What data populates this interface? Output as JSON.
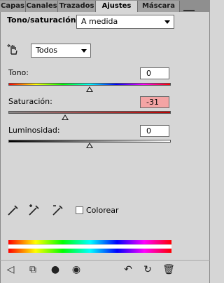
{
  "tabs": [
    "Capas",
    "Canales",
    "Trazados",
    "Ajustes",
    "Máscara"
  ],
  "panel": {
    "title": "Tono/saturación",
    "preset": "A medida",
    "channel": "Todos"
  },
  "adjustments": {
    "tono": {
      "label": "Tono:",
      "value": "0",
      "level": 0.5
    },
    "saturacion": {
      "label": "Saturación:",
      "value": "-31",
      "level": 0.35
    },
    "luminosidad": {
      "label": "Luminosidad:",
      "value": "0",
      "level": 0.5
    }
  },
  "colorize_label": "Colorear",
  "colorize_checked": false,
  "colors": {
    "negative_value_bg": "#f4a4a4",
    "panel_bg": "#d6d6d6"
  },
  "icons": {
    "targeted_adjust": "hand-icon",
    "eyedroppers": [
      "eyedropper-icon",
      "eyedropper-add-icon",
      "eyedropper-subtract-icon"
    ],
    "toolbar": [
      "back-arrow-icon",
      "clip-layer-icon",
      "layer-mask-icon",
      "visibility-eye-icon",
      "previous-state-icon",
      "reset-icon",
      "trash-icon"
    ]
  }
}
